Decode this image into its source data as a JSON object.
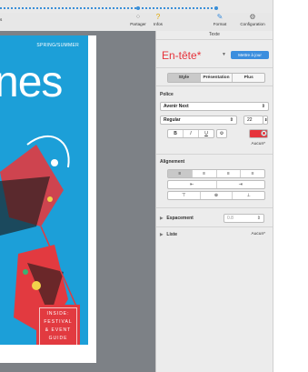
{
  "colors": {
    "accent": "#3b8ede",
    "style_red": "#e6333b",
    "cover_blue": "#1c9fd8",
    "canvas_gray": "#7d8186"
  },
  "toolbar": {
    "left_text": "s",
    "share": {
      "label": "Partager",
      "icon": "share-icon"
    },
    "tips": {
      "label": "Infos",
      "icon": "tips-icon"
    },
    "format": {
      "label": "Format",
      "icon": "format-brush-icon"
    },
    "settings": {
      "label": "Configuration",
      "icon": "gear-icon"
    }
  },
  "document": {
    "season": "SPRING/SUMMER",
    "title_fragment": "nes",
    "inside_lines": [
      "INSIDE:",
      "FESTIVAL",
      "& EVENT",
      "GUIDE"
    ]
  },
  "panel": {
    "title": "Texte",
    "paragraph_style": "En-tête*",
    "update_button": "Mettre à jour",
    "tabs": [
      "Style",
      "Présentation",
      "Plus"
    ],
    "active_tab": "Style",
    "font": {
      "label": "Police",
      "family": "Avenir Next",
      "weight": "Regular",
      "size": "22",
      "char_styles": [
        "B",
        "I",
        "U"
      ],
      "char_style_value": "Aucun*"
    },
    "alignment": {
      "label": "Alignement",
      "horizontal": [
        "≡",
        "≡",
        "≡",
        "≡"
      ],
      "indent": [
        "⇤",
        "⇥"
      ],
      "vertical": [
        "⊤",
        "⊕",
        "⊥"
      ]
    },
    "spacing": {
      "label": "Espacement",
      "value": "0.8"
    },
    "list": {
      "label": "Liste",
      "value": "Aucun*"
    }
  }
}
